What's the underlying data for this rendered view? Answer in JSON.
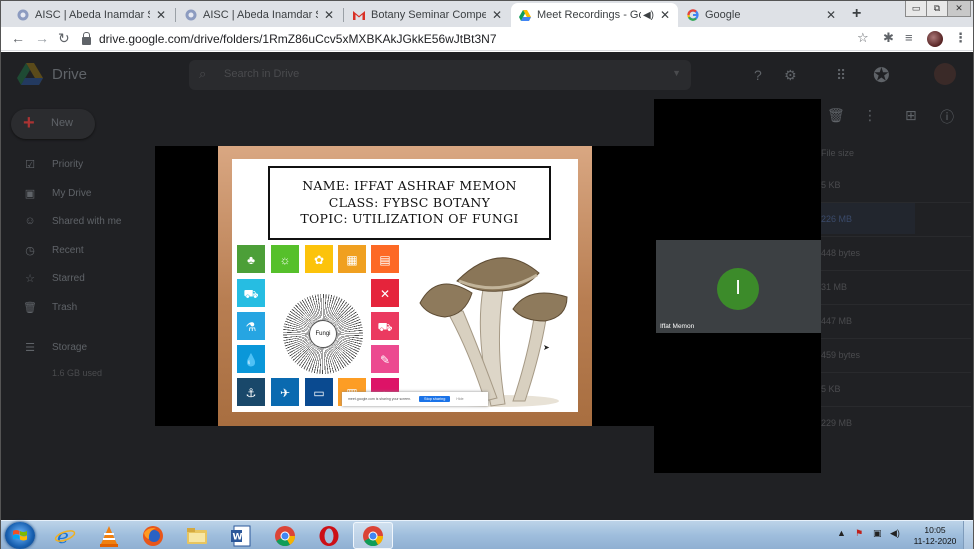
{
  "browser": {
    "tabs": [
      {
        "title": "AISC | Abeda Inamdar Senior Co",
        "favicon": "college-icon",
        "active": false
      },
      {
        "title": "AISC | Abeda Inamdar Senior Co",
        "favicon": "college-icon",
        "active": false
      },
      {
        "title": "Botany Seminar Competition FY",
        "favicon": "gmail-icon",
        "active": false
      },
      {
        "title": "Meet Recordings - Google D",
        "favicon": "drive-icon",
        "active": true
      },
      {
        "title": "Google",
        "favicon": "google-icon",
        "active": false
      }
    ],
    "new_tab_glyph": "+",
    "close_glyph": "✕",
    "url": "drive.google.com/drive/folders/1RmZ86uCcv5xMXBKAkJGkkE56wJtBt3N7"
  },
  "drive": {
    "title": "Drive",
    "search_placeholder": "Search in Drive",
    "new_label": "New",
    "nav": [
      {
        "label": "Priority",
        "icon": "check-circle-icon"
      },
      {
        "label": "My Drive",
        "icon": "my-drive-icon"
      },
      {
        "label": "Shared with me",
        "icon": "shared-icon"
      },
      {
        "label": "Recent",
        "icon": "clock-icon"
      },
      {
        "label": "Starred",
        "icon": "star-icon"
      },
      {
        "label": "Trash",
        "icon": "trash-icon"
      },
      {
        "label": "Storage",
        "icon": "storage-icon"
      }
    ],
    "storage_used": "1.6 GB used",
    "column_header": "File size",
    "file_sizes": [
      "5 KB",
      "226 MB",
      "448 bytes",
      "31 MB",
      "447 MB",
      "459 bytes",
      "5 KB",
      "229 MB"
    ]
  },
  "slide": {
    "name_line": "NAME: IFFAT ASHRAF MEMON",
    "class_line": "CLASS: FYBSC BOTANY",
    "topic_line": "TOPIC: UTILIZATION OF FUNGI",
    "center_label": "Fungi",
    "share_notice": "meet.google.com is sharing your screen.",
    "stop_sharing": "Stop sharing",
    "hide": "Hide"
  },
  "participant": {
    "initial": "I",
    "name": "Iffat Memon",
    "avatar_color": "#3c8b2a"
  },
  "taskbar": {
    "time": "10:05",
    "date": "11-12-2020"
  }
}
